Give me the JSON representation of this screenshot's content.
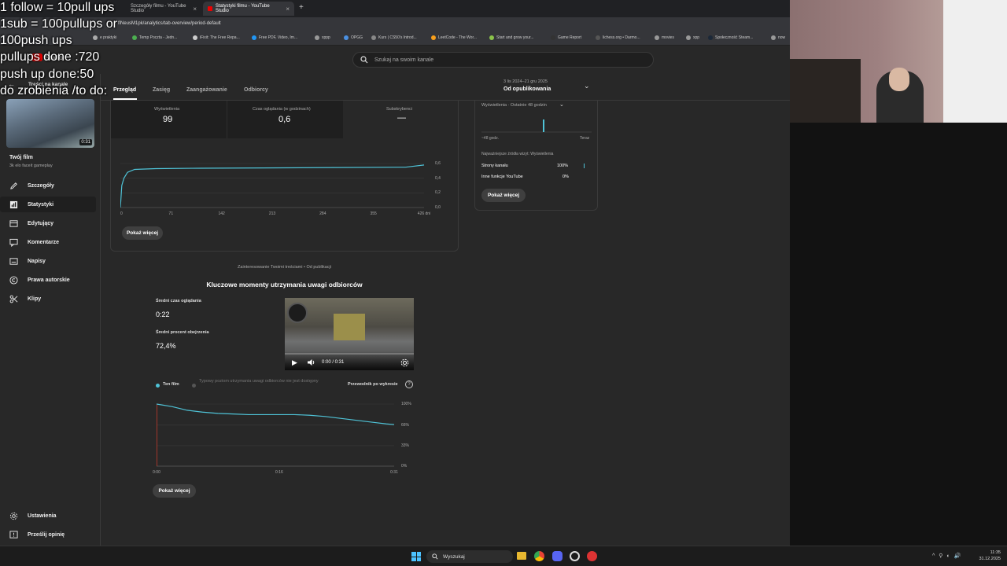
{
  "browser": {
    "tabs": [
      {
        "label": "Szczegóły filmu - YouTube Studio"
      },
      {
        "label": "Statystyki filmu - YouTube Studio"
      }
    ],
    "new_tab": "+",
    "url": "flNeusM1pk/analytics/tab-overview/period-default",
    "bookmarks": [
      "e praktyki",
      "Temp Poczta - Jedn...",
      "iFixit: The Free Repa...",
      "Free PDF, Video, Im...",
      "xppp",
      "OPGG",
      "Kurs | CS50's Introd...",
      "LeetCode - The Wor...",
      "Start and grow your...",
      "Game Report",
      "lichess.org • Darmo...",
      "movies",
      "xpp",
      "Społeczność Steam...",
      "now"
    ]
  },
  "overlay_text": [
    "1 follow = 10pull ups",
    "1sub = 100pullups or",
    "100push ups",
    "pullups done :720",
    "push up done:50",
    "do zrobienia /to do:"
  ],
  "header": {
    "search_placeholder": "Szukaj na swoim kanale",
    "studio_label": "Studio",
    "back_label": "Treści na kanale"
  },
  "sidebar": {
    "video_duration": "0:31",
    "video_title": "Twój film",
    "video_subtitle": "3k elo faceit gameplay",
    "items": [
      {
        "label": "Szczegóły",
        "icon": "pencil-icon"
      },
      {
        "label": "Statystyki",
        "icon": "analytics-icon"
      },
      {
        "label": "Edytujący",
        "icon": "editor-icon"
      },
      {
        "label": "Komentarze",
        "icon": "comment-icon"
      },
      {
        "label": "Napisy",
        "icon": "subtitles-icon"
      },
      {
        "label": "Prawa autorskie",
        "icon": "copyright-icon"
      },
      {
        "label": "Klipy",
        "icon": "scissors-icon"
      }
    ],
    "settings": "Ustawienia",
    "feedback": "Prześlij opinię"
  },
  "tabs": [
    "Przegląd",
    "Zasięg",
    "Zaangażowanie",
    "Odbiorcy"
  ],
  "period": {
    "range": "3 lis 2024–21 gru 2025",
    "label": "Od opublikowania"
  },
  "metrics": [
    {
      "label": "Wyświetlenia",
      "value": "99"
    },
    {
      "label": "Czas oglądania (w godzinach)",
      "value": "0,6"
    },
    {
      "label": "Subskrybenci",
      "value": "—"
    }
  ],
  "main_chart": {
    "x_ticks": [
      "0",
      "71",
      "142",
      "213",
      "284",
      "355",
      "426 dni"
    ],
    "y_ticks": [
      "0,6",
      "0,4",
      "0,2",
      "0,0"
    ],
    "show_more": "Pokaż więcej"
  },
  "chart_data": [
    {
      "type": "line",
      "x": [
        0,
        2,
        5,
        10,
        20,
        50,
        100,
        200,
        300,
        400,
        426
      ],
      "y": [
        0.0,
        0.3,
        0.4,
        0.48,
        0.52,
        0.53,
        0.535,
        0.54,
        0.545,
        0.55,
        0.58
      ],
      "xlabel": "",
      "ylabel": "",
      "xlim": [
        0,
        426
      ],
      "ylim": [
        0,
        0.6
      ]
    },
    {
      "type": "line",
      "x": [
        0,
        2,
        4,
        6,
        8,
        10,
        12,
        14,
        16,
        18,
        20,
        22,
        24,
        26,
        28,
        30,
        31
      ],
      "y": [
        100,
        96,
        90,
        87,
        85,
        84,
        83,
        83,
        83,
        83,
        82,
        80,
        77,
        74,
        71,
        68,
        67
      ],
      "series": [
        {
          "name": "Ten film"
        }
      ],
      "xlim": [
        0,
        31
      ],
      "ylim": [
        0,
        100
      ]
    }
  ],
  "realtime": {
    "title": "Wyświetlenia · Ostatnie 48 godzin",
    "x_left": "~48 godz.",
    "x_right": "Teraz",
    "sources_header": "Najważniejsze źródła wizyt: Wyświetlenia",
    "sources": [
      {
        "label": "Strony kanału",
        "value": "100%"
      },
      {
        "label": "Inne funkcje YouTube",
        "value": "0%"
      }
    ],
    "show_more": "Pokaż więcej"
  },
  "retention": {
    "caption": "Zainteresowanie Twoimi treściami • Od publikacji",
    "title": "Kluczowe momenty utrzymania uwagi odbiorców",
    "avg_time_label": "Średni czas oglądania",
    "avg_time_value": "0:22",
    "avg_pct_label": "Średni procent obejrzenia",
    "avg_pct_value": "72,4%",
    "player_time": "0:00 / 0:31",
    "legend_this": "Ten film",
    "legend_typical": "Typowy poziom utrzymania uwagi odbiorców nie jest dostępny",
    "guide": "Przewodnik po wykresie",
    "x_ticks": [
      "0:00",
      "0:16",
      "0:31"
    ],
    "y_ticks": [
      "100%",
      "66%",
      "33%",
      "0%"
    ],
    "show_more": "Pokaż więcej"
  },
  "taskbar": {
    "search": "Wyszukaj",
    "time": "11:35",
    "date": "31.12.2025"
  },
  "colors": {
    "accent": "#4fc3d7",
    "bg": "#282828",
    "border": "#3a3a3a"
  }
}
